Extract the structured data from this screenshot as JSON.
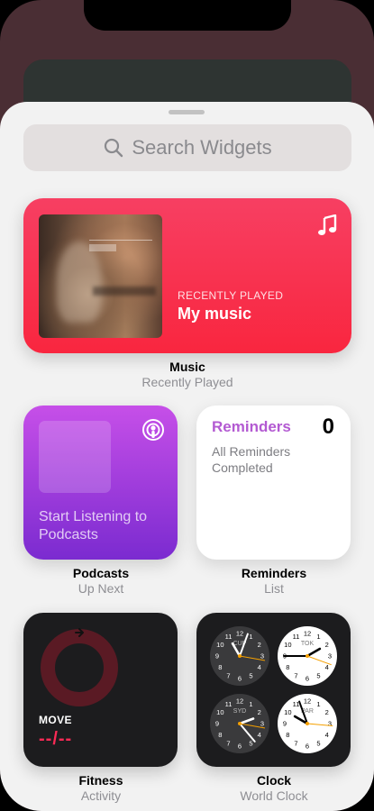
{
  "search": {
    "placeholder": "Search Widgets"
  },
  "widgets": {
    "music": {
      "label": "RECENTLY PLAYED",
      "title": "My music",
      "name": "Music",
      "subtitle": "Recently Played"
    },
    "podcasts": {
      "text": "Start Listening to Podcasts",
      "name": "Podcasts",
      "subtitle": "Up Next"
    },
    "reminders": {
      "title": "Reminders",
      "count": "0",
      "text": "All Reminders Completed",
      "name": "Reminders",
      "subtitle": "List"
    },
    "fitness": {
      "label": "MOVE",
      "value": "--/--",
      "name": "Fitness",
      "subtitle": "Activity"
    },
    "clock": {
      "cities": [
        "CUP",
        "TOK",
        "SYD",
        "PAR"
      ],
      "name": "Clock",
      "subtitle": "World Clock"
    }
  },
  "colors": {
    "music_accent": "#f9263f",
    "podcasts_accent": "#9b3be0",
    "reminders_accent": "#b35ad2",
    "fitness_accent": "#fa2a55"
  },
  "icons": [
    "search-icon",
    "music-note-icon",
    "podcasts-icon",
    "activity-ring-icon"
  ]
}
